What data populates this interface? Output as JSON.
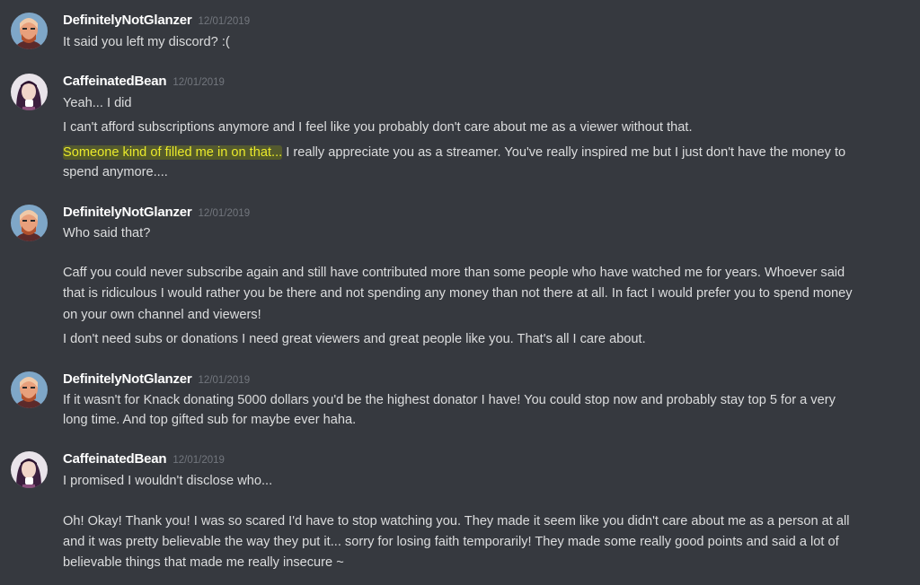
{
  "users": {
    "glanzer": "DefinitelyNotGlanzer",
    "bean": "CaffeinatedBean"
  },
  "messages": [
    {
      "author": "DefinitelyNotGlanzer",
      "timestamp": "12/01/2019",
      "lines": [
        "It said you left my discord? :("
      ]
    },
    {
      "author": "CaffeinatedBean",
      "timestamp": "12/01/2019",
      "lines": [
        "Yeah... I did",
        "I can't afford subscriptions anymore and I feel like you probably don't care about me as a viewer without that.",
        "spend anymore...."
      ],
      "highlight_line": {
        "highlighted": "Someone kind of filled me in on that...",
        "rest": " I really appreciate you as a streamer. You've really inspired me but I just don't have the money to"
      }
    },
    {
      "author": "DefinitelyNotGlanzer",
      "timestamp": "12/01/2019",
      "lines": [
        "Who said that?",
        "Caff you could never subscribe again and still have contributed more than some people who have watched me for years. Whoever said",
        "that is ridiculous I would rather you be there and not spending any money than not there at all. In fact I would prefer you to spend money",
        "on your own channel and viewers!",
        "I don't need subs or donations I need great viewers and great people like you. That's all I care about."
      ]
    },
    {
      "author": "DefinitelyNotGlanzer",
      "timestamp": "12/01/2019",
      "lines": [
        "If it wasn't for Knack donating 5000 dollars you'd be the highest donator I have! You could stop now and probably stay top 5 for a very",
        "long time. And top gifted sub for maybe ever haha."
      ]
    },
    {
      "author": "CaffeinatedBean",
      "timestamp": "12/01/2019",
      "lines": [
        "I promised I wouldn't disclose who...",
        "Oh! Okay! Thank you! I was so scared I'd have to stop watching you. They made it seem like you didn't care about me as a person at all",
        "and it was pretty believable the way they put it... sorry for losing faith temporarily! They made some really good points and said a lot of",
        "believable things that made me really insecure ~"
      ]
    }
  ]
}
